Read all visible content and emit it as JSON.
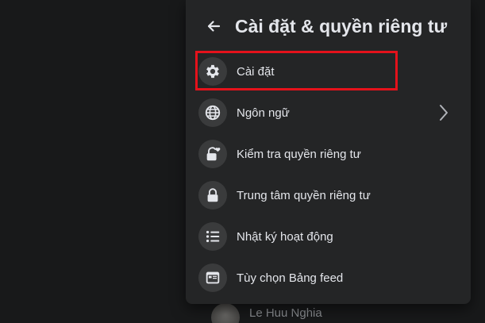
{
  "header": {
    "title": "Cài đặt & quyền riêng tư"
  },
  "menu": {
    "items": [
      {
        "label": "Cài đặt",
        "icon": "gear-icon"
      },
      {
        "label": "Ngôn ngữ",
        "icon": "globe-icon"
      },
      {
        "label": "Kiểm tra quyền riêng tư",
        "icon": "lock-heart-icon"
      },
      {
        "label": "Trung tâm quyền riêng tư",
        "icon": "lock-icon"
      },
      {
        "label": "Nhật ký hoạt động",
        "icon": "list-icon"
      },
      {
        "label": "Tùy chọn Bảng feed",
        "icon": "feed-icon"
      }
    ]
  },
  "below": {
    "user_name": "Le Huu Nghia"
  },
  "colors": {
    "background": "#18191a",
    "panel": "#242526",
    "icon_bg": "#3a3b3c",
    "text": "#e4e6eb",
    "highlight": "#e4121b"
  }
}
